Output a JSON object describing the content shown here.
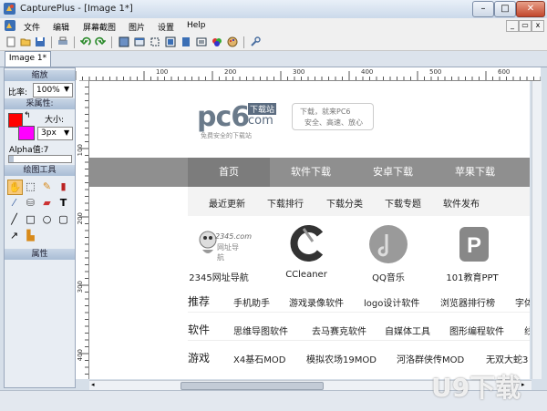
{
  "window": {
    "title": "CapturePlus - [Image 1*]"
  },
  "menu": [
    "文件",
    "编辑",
    "屏幕截图",
    "图片",
    "设置",
    "Help"
  ],
  "tab": {
    "label": "Image 1*"
  },
  "panel": {
    "scale_header": "缩放",
    "scale_label": "比率:",
    "scale_value": "100%",
    "capture_header": "采属性:",
    "size_label": "大小:",
    "stroke_value": "3px",
    "alpha_label": "Alpha值:7",
    "draw_header": "绘图工具",
    "props_header": "属性"
  },
  "colors": {
    "primary": "#ff0000",
    "secondary": "#ff00ff",
    "nav_active": "#7c7c7c",
    "nav_bg": "#8f8f8f"
  },
  "rulers": {
    "h_labels": [
      "100",
      "200",
      "300",
      "400",
      "500",
      "600"
    ],
    "v_labels": [
      "100",
      "200",
      "300",
      "400"
    ]
  },
  "site": {
    "logo_brand": "pc6",
    "logo_com": "com",
    "logo_tag": "下载站",
    "logo_slogan": "免费安全的下载站",
    "slogan_1": "下载，就来PC6",
    "slogan_2": "安全、高速、放心",
    "nav": [
      "首页",
      "软件下载",
      "安卓下载",
      "苹果下载"
    ],
    "subnav": [
      "最近更新",
      "下载排行",
      "下载分类",
      "下载专题",
      "软件发布"
    ],
    "apps": [
      {
        "name": "2345网址导航",
        "icon_text": "2345.com\n网址导航"
      },
      {
        "name": "CCleaner"
      },
      {
        "name": "QQ音乐"
      },
      {
        "name": "101教育PPT",
        "icon_text": "P"
      }
    ],
    "categories": [
      {
        "label": "推荐",
        "items": [
          "手机助手",
          "游戏录像软件",
          "logo设计软件",
          "浏览器排行榜",
          "字体"
        ]
      },
      {
        "label": "软件",
        "items": [
          "思维导图软件",
          "去马赛克软件",
          "自媒体工具",
          "图形编程软件",
          "线"
        ]
      },
      {
        "label": "游戏",
        "items": [
          "X4基石MOD",
          "模拟农场19MOD",
          "河洛群侠传MOD",
          "无双大蛇3"
        ]
      }
    ]
  },
  "watermark": "U9下载"
}
